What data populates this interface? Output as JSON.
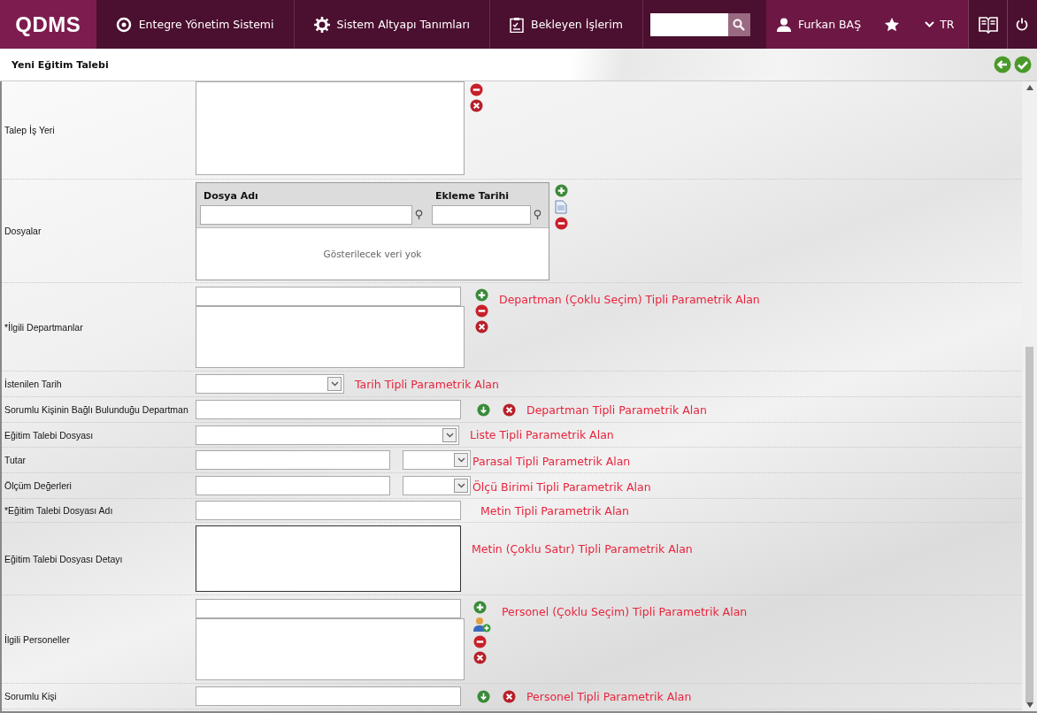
{
  "header": {
    "logo": "QDMS",
    "nav": [
      {
        "label": "Entegre Yönetim Sistemi",
        "kind": "q"
      },
      {
        "label": "Sistem Altyapı Tanımları",
        "kind": "gear"
      },
      {
        "label": "Bekleyen İşlerim",
        "kind": "clipboard"
      }
    ],
    "user": "Furkan BAŞ",
    "language": "TR"
  },
  "page_title": "Yeni Eğitim Talebi",
  "rows": [
    {
      "label": "Talep İş Yeri",
      "kind": "list-partial"
    },
    {
      "label": "Dosyalar",
      "kind": "file-grid",
      "columns": [
        "Dosya Adı",
        "Ekleme Tarihi"
      ],
      "empty": "Gösterilecek veri yok"
    },
    {
      "label": "*İlgili Departmanlar",
      "kind": "multi",
      "note": "Departman (Çoklu Seçim) Tipli Parametrik Alan"
    },
    {
      "label": "İstenilen Tarih",
      "kind": "date",
      "note": "Tarih Tipli Parametrik Alan"
    },
    {
      "label": "Sorumlu Kişinin Bağlı Bulunduğu Departman",
      "kind": "lookup",
      "note": "Departman Tipli Parametrik Alan"
    },
    {
      "label": "Eğitim Talebi Dosyası",
      "kind": "select",
      "note": "Liste Tipli Parametrik Alan"
    },
    {
      "label": "Tutar",
      "kind": "pair",
      "note": "Parasal Tipli Parametrik Alan"
    },
    {
      "label": "Ölçüm Değerleri",
      "kind": "pair",
      "note": "Ölçü Birimi Tipli Parametrik Alan"
    },
    {
      "label": "*Eğitim Talebi Dosyası Adı",
      "kind": "text",
      "note": "Metin Tipli Parametrik Alan"
    },
    {
      "label": "Eğitim Talebi Dosyası Detayı",
      "kind": "textarea",
      "note": "Metin (Çoklu Satır) Tipli  Parametrik Alan"
    },
    {
      "label": "İlgili Personeller",
      "kind": "person-multi",
      "note": "Personel (Çoklu Seçim) Tipli Parametrik Alan"
    },
    {
      "label": "Sorumlu Kişi",
      "kind": "lookup",
      "note": "Personel Tipli Parametrik Alan"
    }
  ]
}
